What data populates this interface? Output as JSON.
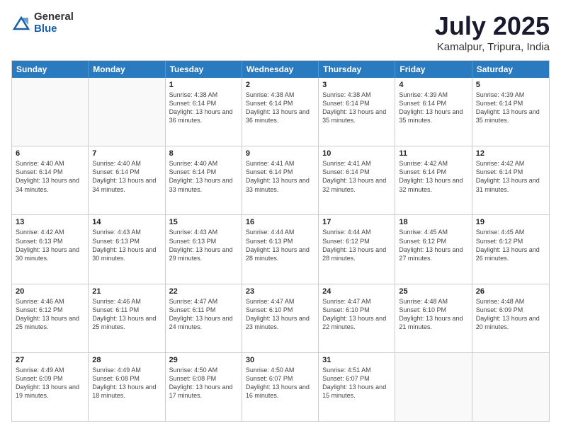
{
  "header": {
    "logo_general": "General",
    "logo_blue": "Blue",
    "title": "July 2025",
    "location": "Kamalpur, Tripura, India"
  },
  "calendar": {
    "days_of_week": [
      "Sunday",
      "Monday",
      "Tuesday",
      "Wednesday",
      "Thursday",
      "Friday",
      "Saturday"
    ],
    "rows": [
      [
        {
          "day": "",
          "empty": true
        },
        {
          "day": "",
          "empty": true
        },
        {
          "day": "1",
          "sunrise": "4:38 AM",
          "sunset": "6:14 PM",
          "daylight": "13 hours and 36 minutes."
        },
        {
          "day": "2",
          "sunrise": "4:38 AM",
          "sunset": "6:14 PM",
          "daylight": "13 hours and 36 minutes."
        },
        {
          "day": "3",
          "sunrise": "4:38 AM",
          "sunset": "6:14 PM",
          "daylight": "13 hours and 35 minutes."
        },
        {
          "day": "4",
          "sunrise": "4:39 AM",
          "sunset": "6:14 PM",
          "daylight": "13 hours and 35 minutes."
        },
        {
          "day": "5",
          "sunrise": "4:39 AM",
          "sunset": "6:14 PM",
          "daylight": "13 hours and 35 minutes."
        }
      ],
      [
        {
          "day": "6",
          "sunrise": "4:40 AM",
          "sunset": "6:14 PM",
          "daylight": "13 hours and 34 minutes."
        },
        {
          "day": "7",
          "sunrise": "4:40 AM",
          "sunset": "6:14 PM",
          "daylight": "13 hours and 34 minutes."
        },
        {
          "day": "8",
          "sunrise": "4:40 AM",
          "sunset": "6:14 PM",
          "daylight": "13 hours and 33 minutes."
        },
        {
          "day": "9",
          "sunrise": "4:41 AM",
          "sunset": "6:14 PM",
          "daylight": "13 hours and 33 minutes."
        },
        {
          "day": "10",
          "sunrise": "4:41 AM",
          "sunset": "6:14 PM",
          "daylight": "13 hours and 32 minutes."
        },
        {
          "day": "11",
          "sunrise": "4:42 AM",
          "sunset": "6:14 PM",
          "daylight": "13 hours and 32 minutes."
        },
        {
          "day": "12",
          "sunrise": "4:42 AM",
          "sunset": "6:14 PM",
          "daylight": "13 hours and 31 minutes."
        }
      ],
      [
        {
          "day": "13",
          "sunrise": "4:42 AM",
          "sunset": "6:13 PM",
          "daylight": "13 hours and 30 minutes."
        },
        {
          "day": "14",
          "sunrise": "4:43 AM",
          "sunset": "6:13 PM",
          "daylight": "13 hours and 30 minutes."
        },
        {
          "day": "15",
          "sunrise": "4:43 AM",
          "sunset": "6:13 PM",
          "daylight": "13 hours and 29 minutes."
        },
        {
          "day": "16",
          "sunrise": "4:44 AM",
          "sunset": "6:13 PM",
          "daylight": "13 hours and 28 minutes."
        },
        {
          "day": "17",
          "sunrise": "4:44 AM",
          "sunset": "6:12 PM",
          "daylight": "13 hours and 28 minutes."
        },
        {
          "day": "18",
          "sunrise": "4:45 AM",
          "sunset": "6:12 PM",
          "daylight": "13 hours and 27 minutes."
        },
        {
          "day": "19",
          "sunrise": "4:45 AM",
          "sunset": "6:12 PM",
          "daylight": "13 hours and 26 minutes."
        }
      ],
      [
        {
          "day": "20",
          "sunrise": "4:46 AM",
          "sunset": "6:12 PM",
          "daylight": "13 hours and 25 minutes."
        },
        {
          "day": "21",
          "sunrise": "4:46 AM",
          "sunset": "6:11 PM",
          "daylight": "13 hours and 25 minutes."
        },
        {
          "day": "22",
          "sunrise": "4:47 AM",
          "sunset": "6:11 PM",
          "daylight": "13 hours and 24 minutes."
        },
        {
          "day": "23",
          "sunrise": "4:47 AM",
          "sunset": "6:10 PM",
          "daylight": "13 hours and 23 minutes."
        },
        {
          "day": "24",
          "sunrise": "4:47 AM",
          "sunset": "6:10 PM",
          "daylight": "13 hours and 22 minutes."
        },
        {
          "day": "25",
          "sunrise": "4:48 AM",
          "sunset": "6:10 PM",
          "daylight": "13 hours and 21 minutes."
        },
        {
          "day": "26",
          "sunrise": "4:48 AM",
          "sunset": "6:09 PM",
          "daylight": "13 hours and 20 minutes."
        }
      ],
      [
        {
          "day": "27",
          "sunrise": "4:49 AM",
          "sunset": "6:09 PM",
          "daylight": "13 hours and 19 minutes."
        },
        {
          "day": "28",
          "sunrise": "4:49 AM",
          "sunset": "6:08 PM",
          "daylight": "13 hours and 18 minutes."
        },
        {
          "day": "29",
          "sunrise": "4:50 AM",
          "sunset": "6:08 PM",
          "daylight": "13 hours and 17 minutes."
        },
        {
          "day": "30",
          "sunrise": "4:50 AM",
          "sunset": "6:07 PM",
          "daylight": "13 hours and 16 minutes."
        },
        {
          "day": "31",
          "sunrise": "4:51 AM",
          "sunset": "6:07 PM",
          "daylight": "13 hours and 15 minutes."
        },
        {
          "day": "",
          "empty": true
        },
        {
          "day": "",
          "empty": true
        }
      ]
    ]
  }
}
